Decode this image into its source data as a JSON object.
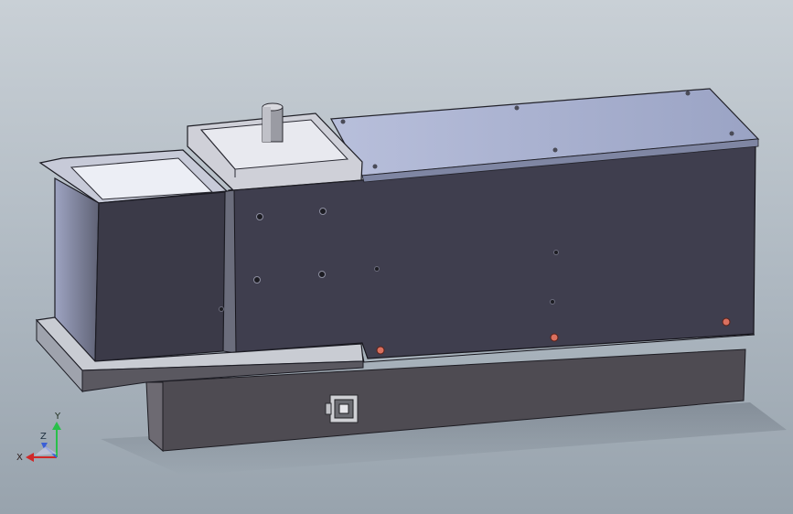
{
  "app": {
    "view_type": "3D CAD model viewport",
    "background": "#b4bec7"
  },
  "model": {
    "name": "",
    "body_color": "#3f3e4e",
    "lid_color": "#a9b1cf",
    "base_color": "#4e4b52",
    "bolt_color": "#d9705f"
  },
  "triad": {
    "x_label": "X",
    "y_label": "Y",
    "z_label": "Z",
    "x_color": "#d02828",
    "y_color": "#29c04a",
    "z_color": "#3b5fd6"
  }
}
